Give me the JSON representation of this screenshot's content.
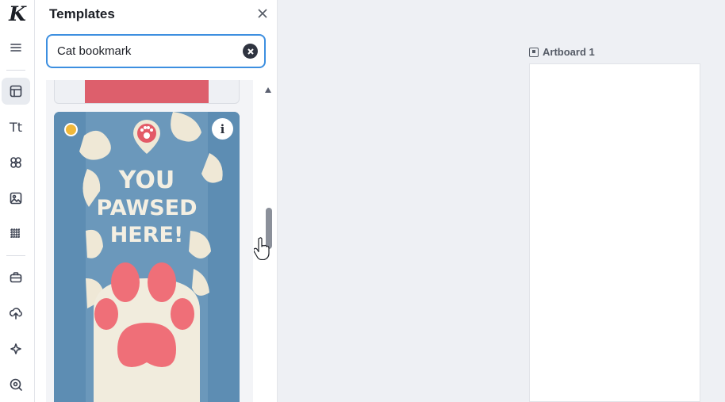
{
  "app": {
    "logo_letter": "K"
  },
  "rail": {
    "items": [
      {
        "icon": "hamburger-menu-icon"
      },
      {
        "icon": "templates-layout-icon",
        "active": true
      },
      {
        "icon": "text-icon",
        "glyph": "Tt"
      },
      {
        "icon": "elements-icon"
      },
      {
        "icon": "photos-icon"
      },
      {
        "icon": "pattern-grid-icon"
      },
      {
        "icon": "briefcase-icon"
      },
      {
        "icon": "upload-cloud-icon"
      },
      {
        "icon": "magic-sparkle-icon"
      },
      {
        "icon": "zoom-search-icon"
      }
    ]
  },
  "panel": {
    "title": "Templates",
    "search": {
      "value": "Cat bookmark",
      "placeholder": ""
    }
  },
  "template_card": {
    "headline_1": "YOU",
    "headline_2": "PAWSED",
    "headline_3": "HERE!",
    "premium": true,
    "colors": {
      "background": "#5f8eb3",
      "paper": "#f1ecdd",
      "paw": "#ef6f78"
    }
  },
  "canvas": {
    "artboard_label": "Artboard 1"
  }
}
